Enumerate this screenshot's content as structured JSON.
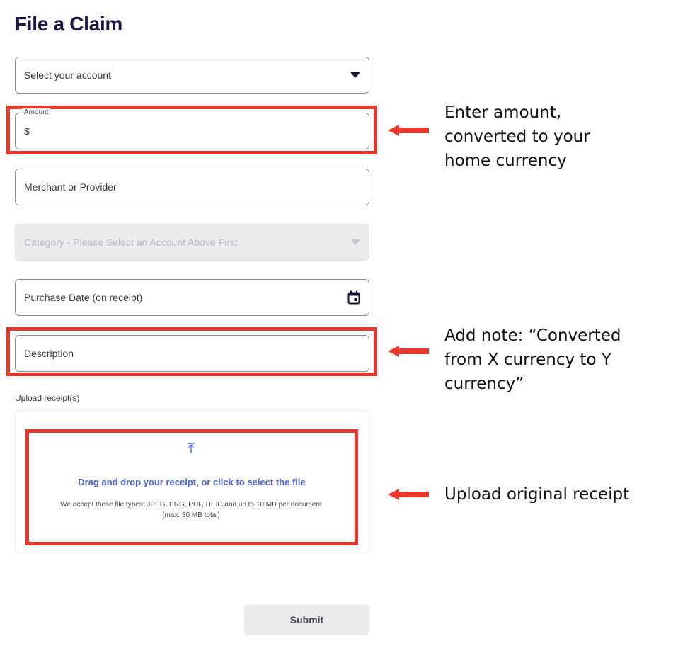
{
  "page": {
    "title": "File a Claim"
  },
  "form": {
    "account_select": {
      "label": "Select your account"
    },
    "amount": {
      "legend": "Amount",
      "prefix": "$"
    },
    "merchant": {
      "placeholder": "Merchant or Provider"
    },
    "category": {
      "placeholder": "Category - Please Select an Account Above First"
    },
    "purchase_date": {
      "placeholder": "Purchase Date (on receipt)"
    },
    "description": {
      "placeholder": "Description"
    },
    "upload": {
      "label": "Upload receipt(s)",
      "prompt": "Drag and drop your receipt, or click to select the file",
      "file_types": "We accept these file types: JPEG, PNG, PDF, HEIC and up to 10 MB per document (max. 30 MB total)"
    },
    "submit_label": "Submit"
  },
  "annotations": {
    "amount_note": "Enter amount, converted to your home currency",
    "description_note": "Add note: “Converted from X currency to Y currency”",
    "upload_note": "Upload original receipt"
  },
  "colors": {
    "title": "#1f1547",
    "highlight": "#e8372b",
    "link": "#4a63d6",
    "disabled": "#ececee"
  }
}
